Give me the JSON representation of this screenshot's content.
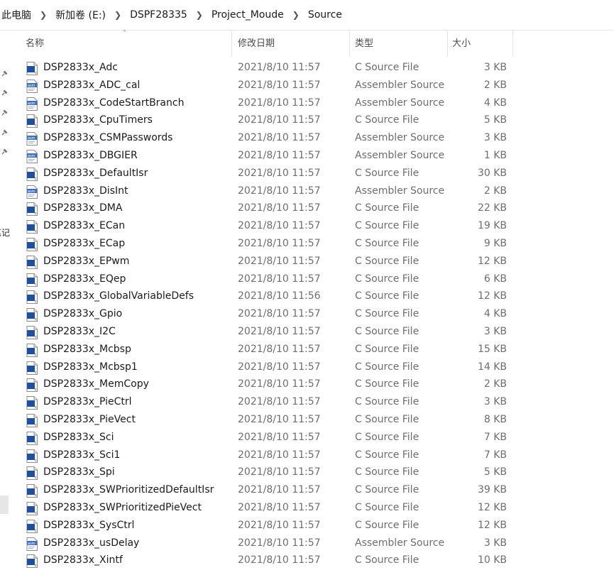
{
  "breadcrumb": [
    "此电脑",
    "新加卷 (E:)",
    "DSPF28335",
    "Project_Moude",
    "Source"
  ],
  "nav": {
    "partial_label": "笔记"
  },
  "columns": {
    "name": "名称",
    "date": "修改日期",
    "type": "类型",
    "size": "大小"
  },
  "icon_names": {
    "c": "c-source-file-icon",
    "asm": "assembler-source-icon"
  },
  "files": [
    {
      "name": "DSP2833x_Adc",
      "date": "2021/8/10 11:57",
      "type": "C Source File",
      "size": "3 KB",
      "icon": "c"
    },
    {
      "name": "DSP2833x_ADC_cal",
      "date": "2021/8/10 11:57",
      "type": "Assembler Source",
      "size": "2 KB",
      "icon": "asm"
    },
    {
      "name": "DSP2833x_CodeStartBranch",
      "date": "2021/8/10 11:57",
      "type": "Assembler Source",
      "size": "4 KB",
      "icon": "asm"
    },
    {
      "name": "DSP2833x_CpuTimers",
      "date": "2021/8/10 11:57",
      "type": "C Source File",
      "size": "5 KB",
      "icon": "c"
    },
    {
      "name": "DSP2833x_CSMPasswords",
      "date": "2021/8/10 11:57",
      "type": "Assembler Source",
      "size": "3 KB",
      "icon": "asm"
    },
    {
      "name": "DSP2833x_DBGIER",
      "date": "2021/8/10 11:57",
      "type": "Assembler Source",
      "size": "1 KB",
      "icon": "asm"
    },
    {
      "name": "DSP2833x_DefaultIsr",
      "date": "2021/8/10 11:57",
      "type": "C Source File",
      "size": "30 KB",
      "icon": "c"
    },
    {
      "name": "DSP2833x_DisInt",
      "date": "2021/8/10 11:57",
      "type": "Assembler Source",
      "size": "2 KB",
      "icon": "asm"
    },
    {
      "name": "DSP2833x_DMA",
      "date": "2021/8/10 11:57",
      "type": "C Source File",
      "size": "22 KB",
      "icon": "c"
    },
    {
      "name": "DSP2833x_ECan",
      "date": "2021/8/10 11:57",
      "type": "C Source File",
      "size": "19 KB",
      "icon": "c"
    },
    {
      "name": "DSP2833x_ECap",
      "date": "2021/8/10 11:57",
      "type": "C Source File",
      "size": "9 KB",
      "icon": "c"
    },
    {
      "name": "DSP2833x_EPwm",
      "date": "2021/8/10 11:57",
      "type": "C Source File",
      "size": "12 KB",
      "icon": "c"
    },
    {
      "name": "DSP2833x_EQep",
      "date": "2021/8/10 11:57",
      "type": "C Source File",
      "size": "6 KB",
      "icon": "c"
    },
    {
      "name": "DSP2833x_GlobalVariableDefs",
      "date": "2021/8/10 11:56",
      "type": "C Source File",
      "size": "12 KB",
      "icon": "c"
    },
    {
      "name": "DSP2833x_Gpio",
      "date": "2021/8/10 11:57",
      "type": "C Source File",
      "size": "4 KB",
      "icon": "c"
    },
    {
      "name": "DSP2833x_I2C",
      "date": "2021/8/10 11:57",
      "type": "C Source File",
      "size": "3 KB",
      "icon": "c"
    },
    {
      "name": "DSP2833x_Mcbsp",
      "date": "2021/8/10 11:57",
      "type": "C Source File",
      "size": "15 KB",
      "icon": "c"
    },
    {
      "name": "DSP2833x_Mcbsp1",
      "date": "2021/8/10 11:57",
      "type": "C Source File",
      "size": "14 KB",
      "icon": "c"
    },
    {
      "name": "DSP2833x_MemCopy",
      "date": "2021/8/10 11:57",
      "type": "C Source File",
      "size": "2 KB",
      "icon": "c"
    },
    {
      "name": "DSP2833x_PieCtrl",
      "date": "2021/8/10 11:57",
      "type": "C Source File",
      "size": "3 KB",
      "icon": "c"
    },
    {
      "name": "DSP2833x_PieVect",
      "date": "2021/8/10 11:57",
      "type": "C Source File",
      "size": "8 KB",
      "icon": "c"
    },
    {
      "name": "DSP2833x_Sci",
      "date": "2021/8/10 11:57",
      "type": "C Source File",
      "size": "7 KB",
      "icon": "c"
    },
    {
      "name": "DSP2833x_Sci1",
      "date": "2021/8/10 11:57",
      "type": "C Source File",
      "size": "7 KB",
      "icon": "c"
    },
    {
      "name": "DSP2833x_Spi",
      "date": "2021/8/10 11:57",
      "type": "C Source File",
      "size": "5 KB",
      "icon": "c"
    },
    {
      "name": "DSP2833x_SWPrioritizedDefaultIsr",
      "date": "2021/8/10 11:57",
      "type": "C Source File",
      "size": "39 KB",
      "icon": "c"
    },
    {
      "name": "DSP2833x_SWPrioritizedPieVect",
      "date": "2021/8/10 11:57",
      "type": "C Source File",
      "size": "12 KB",
      "icon": "c"
    },
    {
      "name": "DSP2833x_SysCtrl",
      "date": "2021/8/10 11:57",
      "type": "C Source File",
      "size": "12 KB",
      "icon": "c"
    },
    {
      "name": "DSP2833x_usDelay",
      "date": "2021/8/10 11:57",
      "type": "Assembler Source",
      "size": "3 KB",
      "icon": "asm"
    },
    {
      "name": "DSP2833x_Xintf",
      "date": "2021/8/10 11:57",
      "type": "C Source File",
      "size": "10 KB",
      "icon": "c"
    }
  ]
}
